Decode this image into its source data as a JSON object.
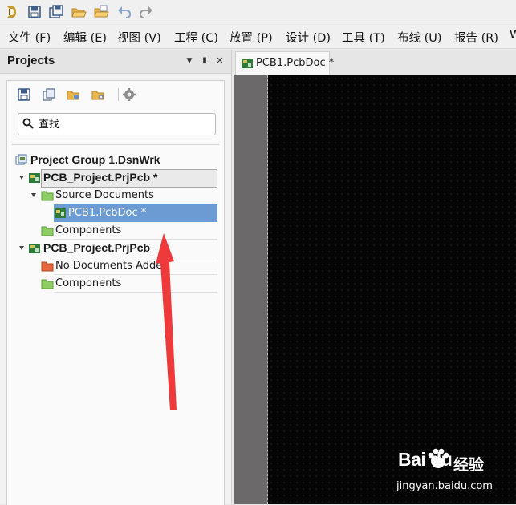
{
  "quick_access": {
    "icons": [
      "app-logo-icon",
      "save-icon",
      "save-all-icon",
      "open-folder-icon",
      "open-project-icon",
      "undo-icon",
      "redo-icon"
    ]
  },
  "menu": {
    "items": [
      {
        "label": "文件 (F)"
      },
      {
        "label": "编辑 (E)"
      },
      {
        "label": "视图 (V)"
      },
      {
        "label": "工程 (C)"
      },
      {
        "label": "放置 (P)"
      },
      {
        "label": "设计 (D)"
      },
      {
        "label": "工具 (T)"
      },
      {
        "label": "布线 (U)"
      },
      {
        "label": "报告 (R)"
      },
      {
        "label": "W"
      }
    ]
  },
  "panel": {
    "title": "Projects",
    "header_buttons": {
      "dropdown": "▼",
      "pin": "▮",
      "close": "✕"
    },
    "search": {
      "placeholder": "查找"
    },
    "tree": {
      "group": "Project Group 1.DsnWrk",
      "project1": {
        "label": "PCB_Project.PrjPcb *",
        "source_documents": "Source Documents",
        "file": "PCB1.PcbDoc *",
        "components": "Components"
      },
      "project2": {
        "label": "PCB_Project.PrjPcb",
        "no_documents": "No Documents Added",
        "components": "Components"
      }
    }
  },
  "document": {
    "tab_label": "PCB1.PcbDoc *"
  },
  "watermark": {
    "logo": "Bai  du",
    "text": "经验",
    "url": "jingyan.baidu.com"
  },
  "colors": {
    "selection": "#6b9bd2",
    "canvas": "#050505",
    "arrow": "#ee3a3a",
    "folder": "#8fce64",
    "folder_empty": "#e8663d"
  }
}
